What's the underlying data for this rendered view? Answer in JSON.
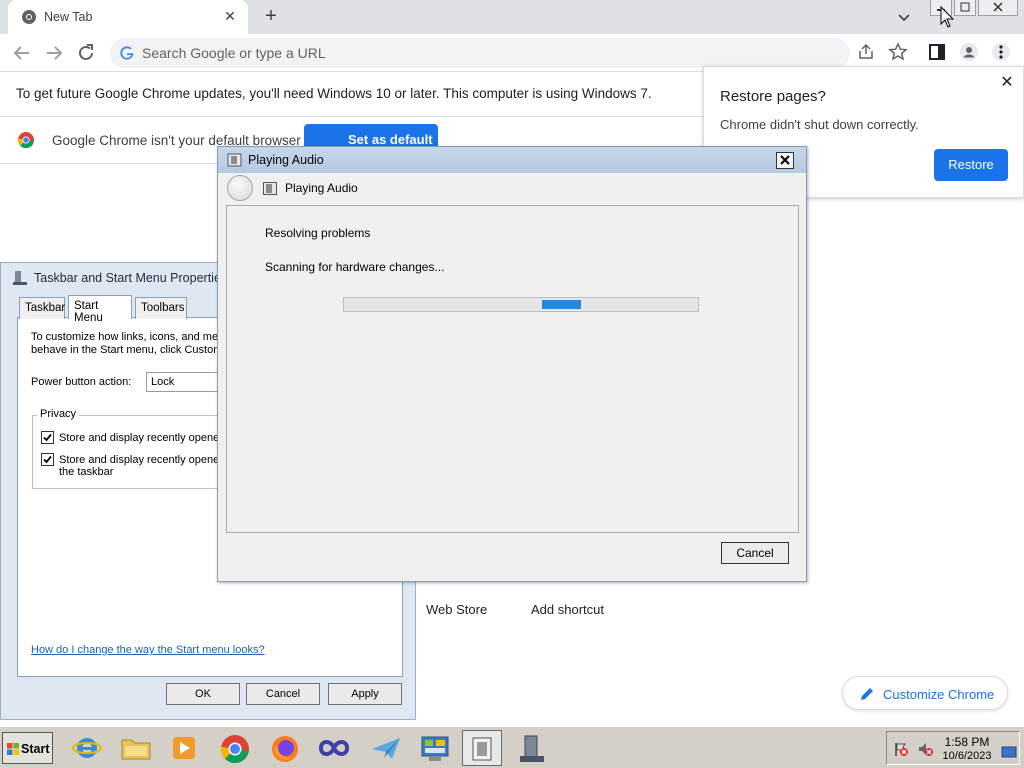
{
  "browser": {
    "tab_title": "New Tab",
    "new_tab_symbol": "+",
    "omnibox_placeholder": "Search Google or type a URL",
    "update_notice": "To get future Google Chrome updates, you'll need Windows 10 or later. This computer is using Windows 7.",
    "default_notice": "Google Chrome isn't your default browser",
    "set_default_label": "Set as default",
    "restore_title": "Restore pages?",
    "restore_message": "Chrome didn't shut down correctly.",
    "restore_button": "Restore",
    "shortcuts": [
      "Web Store",
      "Add shortcut"
    ],
    "customize_label": "Customize Chrome",
    "accent_color": "#1a73e8"
  },
  "taskbar_props": {
    "title": "Taskbar and Start Menu Properties",
    "tabs": [
      "Taskbar",
      "Start Menu",
      "Toolbars"
    ],
    "selected_tab": "Start Menu",
    "description_lines": [
      "To customize how links, icons, and men",
      "behave in the Start menu, click Custom"
    ],
    "power_label": "Power button action:",
    "power_value": "Lock",
    "privacy_label": "Privacy",
    "checkbox1": "Store and display recently opene",
    "checkbox2_lines": [
      "Store and display recently opene",
      "the taskbar"
    ],
    "help_link": "How do I change the way the Start menu looks?",
    "ok": "OK",
    "cancel": "Cancel",
    "apply": "Apply"
  },
  "audio_dialog": {
    "title": "Playing Audio",
    "header": "Playing Audio",
    "status1": "Resolving problems",
    "status2": "Scanning for hardware changes...",
    "progress": 0.11,
    "progress_offset": 0.56,
    "cancel": "Cancel",
    "progress_color": "#2a87dc"
  },
  "taskbar": {
    "start_label": "Start",
    "apps": [
      "internet-explorer-icon",
      "file-explorer-icon",
      "media-player-icon",
      "chrome-icon",
      "firefox-icon",
      "visual-studio-icon",
      "paper-plane-icon",
      "control-panel-icon",
      "audio-troubleshooter-icon",
      "taskbar-properties-icon"
    ],
    "time": "1:58 PM",
    "date": "10/6/2023"
  }
}
